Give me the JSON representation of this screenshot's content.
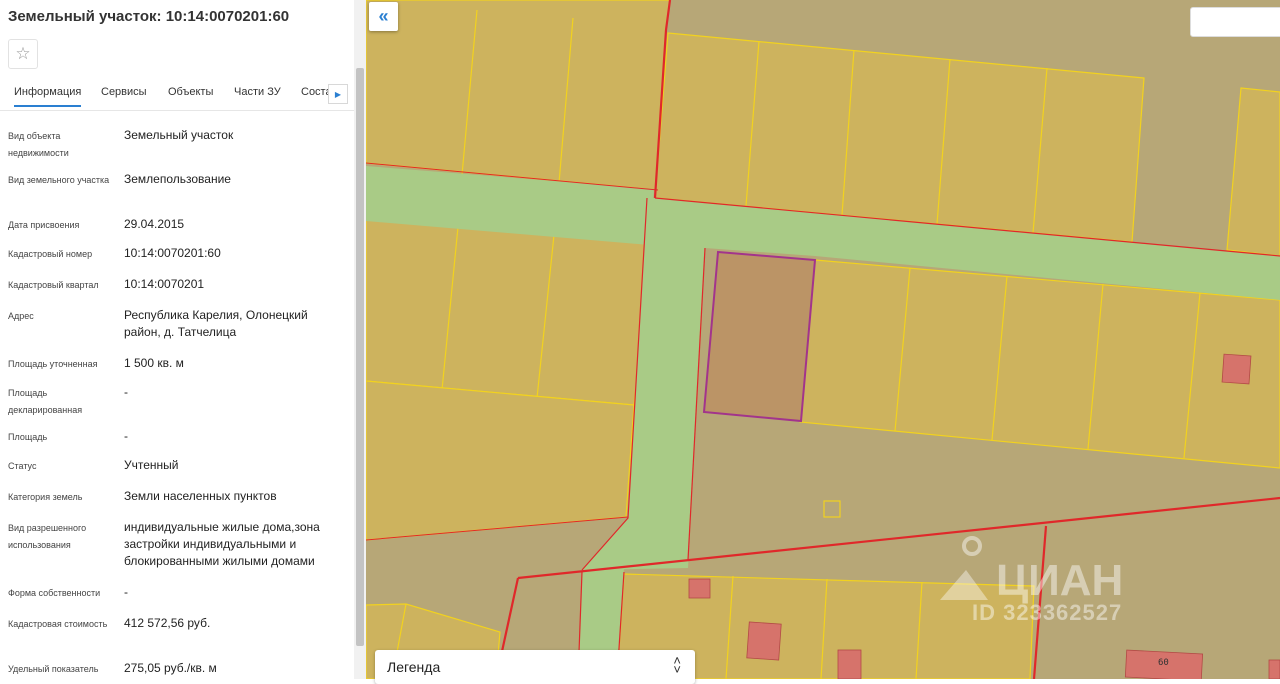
{
  "panel": {
    "title": "Земельный участок: 10:14:0070201:60",
    "tabs": [
      "Информация",
      "Сервисы",
      "Объекты",
      "Части ЗУ",
      "Соста"
    ],
    "fields": [
      {
        "label": "Вид объекта недвижимости",
        "value": "Земельный участок"
      },
      {
        "label": "Вид земельного участка",
        "value": "Землепользование"
      },
      {
        "label": "Дата присвоения",
        "value": "29.04.2015"
      },
      {
        "label": "Кадастровый номер",
        "value": "10:14:0070201:60"
      },
      {
        "label": "Кадастровый квартал",
        "value": "10:14:0070201"
      },
      {
        "label": "Адрес",
        "value": "Республика Карелия, Олонецкий район, д. Татчелица"
      },
      {
        "label": "Площадь уточненная",
        "value": "1 500 кв. м"
      },
      {
        "label": "Площадь декларированная",
        "value": "-"
      },
      {
        "label": "Площадь",
        "value": "-"
      },
      {
        "label": "Статус",
        "value": "Учтенный"
      },
      {
        "label": "Категория земель",
        "value": "Земли населенных пунктов"
      },
      {
        "label": "Вид разрешенного использования",
        "value": "индивидуальные жилые дома,зона застройки индивидуальными и блокированными жилыми домами"
      },
      {
        "label": "Форма собственности",
        "value": "-"
      },
      {
        "label": "Кадастровая стоимость",
        "value": "412 572,56 руб."
      },
      {
        "label": "Удельный показатель",
        "value": "275,05 руб./кв. м"
      }
    ]
  },
  "map": {
    "legend_label": "Легенда",
    "plot_label": "60",
    "watermark_brand": "ЦИАН",
    "watermark_id": "ID 323362527",
    "colors": {
      "background": "#b7a777",
      "parcel": "#cdb35e",
      "parcel_border": "#f2d21e",
      "road": "#a9cb86",
      "selected_parcel": "#bb9466",
      "selected_border": "#a2348c",
      "building": "#d6736b",
      "quarter_border": "#e0282a"
    }
  }
}
